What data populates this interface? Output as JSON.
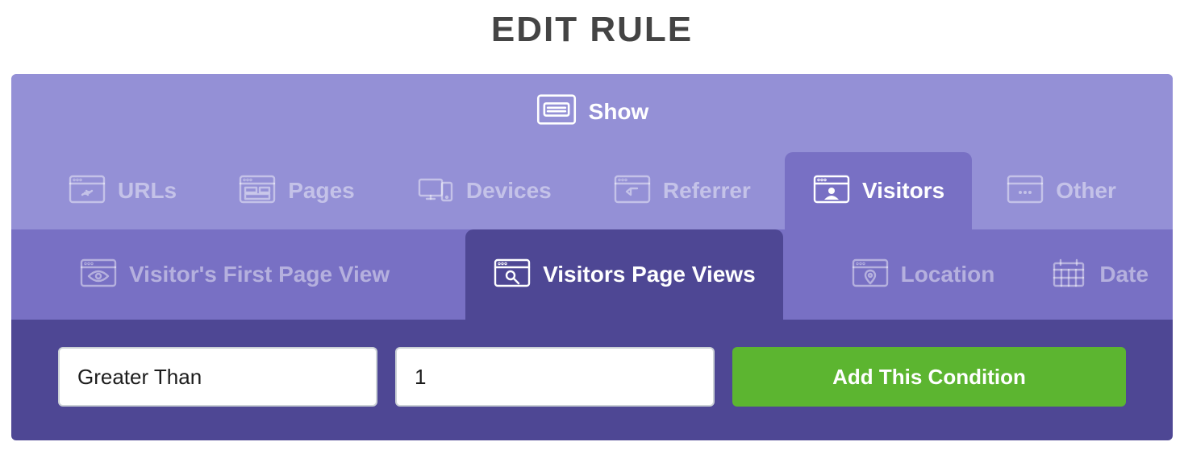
{
  "title": "EDIT RULE",
  "header": {
    "show_label": "Show"
  },
  "primary_tabs": [
    {
      "label": "URLs",
      "active": false
    },
    {
      "label": "Pages",
      "active": false
    },
    {
      "label": "Devices",
      "active": false
    },
    {
      "label": "Referrer",
      "active": false
    },
    {
      "label": "Visitors",
      "active": true
    },
    {
      "label": "Other",
      "active": false
    }
  ],
  "sub_tabs": [
    {
      "label": "Visitor's First Page View",
      "active": false
    },
    {
      "label": "Visitors Page Views",
      "active": true
    },
    {
      "label": "Location",
      "active": false
    },
    {
      "label": "Date",
      "active": false
    }
  ],
  "condition": {
    "comparator": "Greater Than",
    "value": "1",
    "add_label": "Add This Condition"
  }
}
